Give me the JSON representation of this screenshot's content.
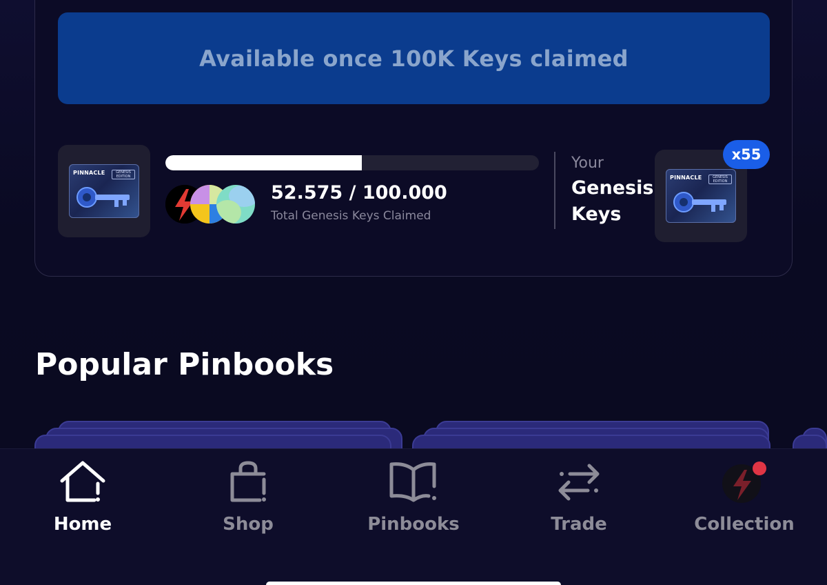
{
  "banner": {
    "text": "Available once 100K Keys claimed"
  },
  "genesis_progress": {
    "claimed_text": "52.575 / 100.000",
    "claimed": 52575,
    "total": 100000,
    "fill_fraction": 0.52575,
    "caption": "Total Genesis Keys Claimed"
  },
  "key_card": {
    "brand": "PINNACLE",
    "edition": "GENESIS EDITION"
  },
  "your_keys": {
    "label": "Your",
    "title": "Genesis Keys",
    "count_badge": "x55"
  },
  "popular": {
    "title": "Popular Pinbooks"
  },
  "nav": {
    "items": [
      {
        "label": "Home",
        "icon": "home-icon",
        "active": true
      },
      {
        "label": "Shop",
        "icon": "shopping-bag-icon",
        "active": false
      },
      {
        "label": "Pinbooks",
        "icon": "book-icon",
        "active": false
      },
      {
        "label": "Trade",
        "icon": "swap-arrows-icon",
        "active": false
      },
      {
        "label": "Collection",
        "icon": "collection-bolt-icon",
        "active": false
      }
    ]
  },
  "colors": {
    "background": "#0b0a24",
    "banner": "#0b3c8e",
    "badge": "#1a5ee8",
    "active_nav": "#ffffff",
    "inactive_nav": "#8d8c98",
    "notification_dot": "#e03545"
  }
}
